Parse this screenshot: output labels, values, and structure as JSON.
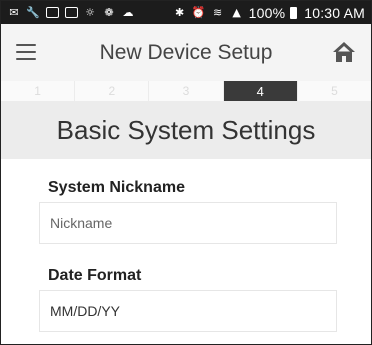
{
  "status_bar": {
    "battery": "100%",
    "time": "10:30 AM"
  },
  "app_bar": {
    "title": "New Device Setup"
  },
  "steps": [
    "1",
    "2",
    "3",
    "4",
    "5"
  ],
  "active_step": "4",
  "section": {
    "title": "Basic System Settings"
  },
  "fields": {
    "nickname": {
      "label": "System Nickname",
      "placeholder": "Nickname",
      "value": ""
    },
    "date_format": {
      "label": "Date Format",
      "value": "MM/DD/YY"
    }
  }
}
